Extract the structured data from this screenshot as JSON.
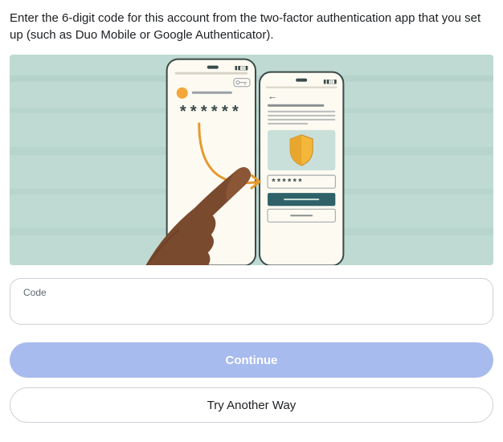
{
  "instruction": "Enter the 6-digit code for this account from the two-factor authentication app that you set up (such as Duo Mobile or Google Authenticator).",
  "input": {
    "label": "Code",
    "value": ""
  },
  "buttons": {
    "continue": "Continue",
    "try_another": "Try Another Way"
  },
  "illustration": {
    "masked_code": "******",
    "icon": "shield-icon"
  }
}
